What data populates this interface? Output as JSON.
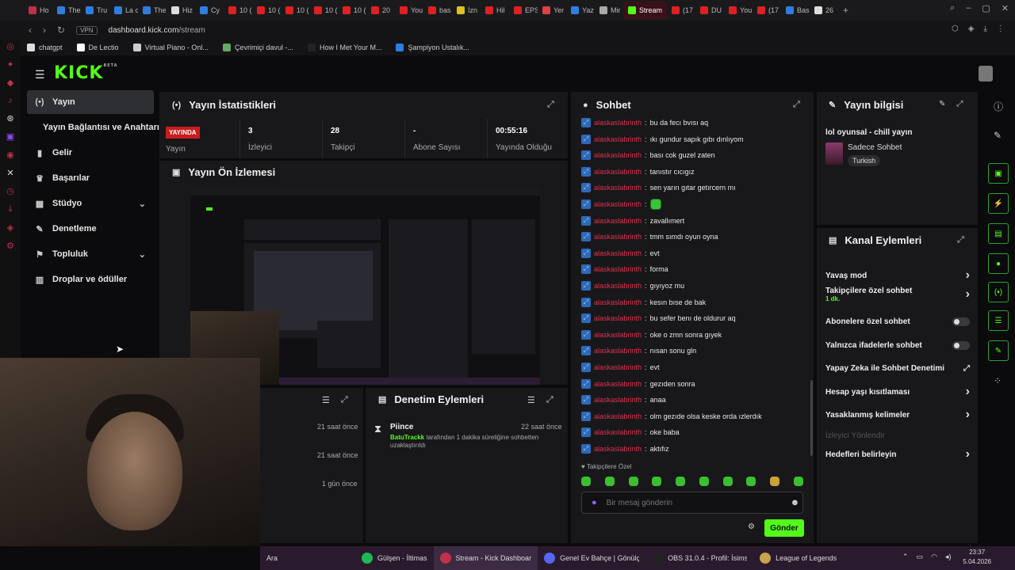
{
  "browser": {
    "tabs": [
      {
        "label": "Ho",
        "color": "#c0304a"
      },
      {
        "label": "The",
        "color": "#2f7de0"
      },
      {
        "label": "Tru",
        "color": "#2f7de0"
      },
      {
        "label": "La c",
        "color": "#2f7de0"
      },
      {
        "label": "The",
        "color": "#2f7de0"
      },
      {
        "label": "Hiz",
        "color": "#ddd"
      },
      {
        "label": "Cy",
        "color": "#2f7de0"
      },
      {
        "label": "10 (",
        "color": "#e02020"
      },
      {
        "label": "10 (",
        "color": "#e02020"
      },
      {
        "label": "10 (",
        "color": "#e02020"
      },
      {
        "label": "10 (",
        "color": "#e02020"
      },
      {
        "label": "10 (",
        "color": "#e02020"
      },
      {
        "label": "20",
        "color": "#e02020"
      },
      {
        "label": "You",
        "color": "#e02020"
      },
      {
        "label": "bas",
        "color": "#e02020"
      },
      {
        "label": "İzn",
        "color": "#e0c020"
      },
      {
        "label": "Hil",
        "color": "#e02020"
      },
      {
        "label": "EPS",
        "color": "#e02020"
      },
      {
        "label": "Yer",
        "color": "#e04040"
      },
      {
        "label": "Yaz",
        "color": "#2f7de0"
      },
      {
        "label": "Mir",
        "color": "#aaa"
      },
      {
        "label": "Stream",
        "color": "#53fc18",
        "active": true
      },
      {
        "label": "(17",
        "color": "#e02020"
      },
      {
        "label": "DU",
        "color": "#e02020"
      },
      {
        "label": "You",
        "color": "#e02020"
      },
      {
        "label": "(17",
        "color": "#e02020"
      },
      {
        "label": "Bas",
        "color": "#2f7de0"
      },
      {
        "label": "26",
        "color": "#ddd"
      }
    ],
    "vpn": "VPN",
    "url_host": "dashboard.kick.com",
    "url_path": "/stream",
    "bookmarks": [
      {
        "label": "chatgpt",
        "color": "#ddd"
      },
      {
        "label": "De Lectio",
        "color": "#fff"
      },
      {
        "label": "Virtual Piano - Onl...",
        "color": "#ccc"
      },
      {
        "label": "Çevrimiçi davul -...",
        "color": "#6a6"
      },
      {
        "label": "How I Met Your M...",
        "color": "#222"
      },
      {
        "label": "Şampiyon Ustalık...",
        "color": "#2f7de0"
      }
    ]
  },
  "kick": {
    "logo": "KICK",
    "logo_sup": "BETA",
    "nav": [
      {
        "label": "Yayın",
        "icon": "broadcast-icon",
        "active": true
      },
      {
        "label": "Yayın Bağlantısı ve Anahtarı",
        "icon": "",
        "sub": true
      },
      {
        "label": "Gelir",
        "icon": "chart-icon"
      },
      {
        "label": "Başarılar",
        "icon": "trophy-icon"
      },
      {
        "label": "Stüdyo",
        "icon": "studio-icon",
        "chevron": true
      },
      {
        "label": "Denetleme",
        "icon": "wrench-icon"
      },
      {
        "label": "Topluluk",
        "icon": "community-icon",
        "chevron": true
      },
      {
        "label": "Droplar ve ödüller",
        "icon": "drops-icon"
      }
    ],
    "stats_panel": {
      "title": "Yayın İstatistikleri",
      "live_badge": "YAYINDA",
      "items": [
        {
          "value": "",
          "label": "Yayın"
        },
        {
          "value": "3",
          "label": "İzleyici"
        },
        {
          "value": "28",
          "label": "Takipçi"
        },
        {
          "value": "-",
          "label": "Abone Sayısı"
        },
        {
          "value": "00:55:16",
          "label": "Yayında Olduğu"
        }
      ]
    },
    "preview_panel": {
      "title": "Yayın Ön İzlemesi"
    },
    "lower_left": {
      "times": [
        "21 saat önce",
        "21 saat önce",
        "1 gün önce"
      ]
    },
    "moderation_panel": {
      "title": "Denetim Eylemleri",
      "entry_user": "Piince",
      "entry_time": "22 saat önce",
      "entry_actor": "BatuTrackk",
      "entry_text": "tarafından 1 dakika süreliğine sohbetten uzaklaştırıldı"
    },
    "chat": {
      "title": "Sohbet",
      "username": "alaskaslabrinth",
      "messages": [
        "bu da fecı bvısı aq",
        "ıkı gundur sapık gıbı dınlıyom",
        "bası cok guzel zaten",
        "tanıstır cıcıgız",
        "sen yarın gıtar getırcern mı",
        "",
        "zavallımert",
        "tmm sımdı oyun oyna",
        "evt",
        "forma",
        "gıyıyoz mu",
        "kesın bıse de bak",
        "bu sefer benı de oldurur aq",
        "oke o zmn sonra gıyek",
        "nısan sonu gln",
        "evt",
        "gezıden sonra",
        "anaa",
        "olm gezıde olsa keske orda ızlerdık",
        "oke baba",
        "aktıfız"
      ],
      "followers_only": "Takipçilere Özel",
      "input_placeholder": "Bir mesaj gönderin",
      "send_label": "Gönder"
    },
    "stream_info": {
      "title": "Yayın bilgisi",
      "stream_title": "lol oyunsal - chill yayın",
      "category": "Sadece Sohbet",
      "language": "Turkish"
    },
    "channel_actions": {
      "title": "Kanal Eylemleri",
      "items": [
        {
          "label": "Yavaş mod",
          "type": "chevron"
        },
        {
          "label": "Takipçilere özel sohbet",
          "sub": "1 dk.",
          "type": "chevron"
        },
        {
          "label": "Abonelere özel sohbet",
          "type": "toggle"
        },
        {
          "label": "Yalnızca ifadelerle sohbet",
          "type": "toggle"
        },
        {
          "label": "Yapay Zeka ile Sohbet Denetimi",
          "type": "external"
        },
        {
          "label": "Hesap yaşı kısıtlaması",
          "type": "chevron"
        },
        {
          "label": "Yasaklanmış kelimeler",
          "type": "chevron"
        },
        {
          "label": "İzleyici Yönlendir",
          "type": "disabled"
        },
        {
          "label": "Hedefleri belirleyin",
          "type": "chevron"
        }
      ]
    }
  },
  "taskbar": {
    "search": "Ara",
    "items": [
      {
        "label": "Gülşen - İltimas",
        "color": "#1db954"
      },
      {
        "label": "Stream - Kick Dashboar",
        "color": "#c0304a",
        "active": true
      },
      {
        "label": "Genel Ev Bahçe | Gönülç",
        "color": "#5865f2"
      },
      {
        "label": "OBS 31.0.4 - Profil: İsimsi",
        "color": "#222"
      },
      {
        "label": "League of Legends",
        "color": "#c8a44a"
      }
    ],
    "time": "23:37",
    "date": "5.04.2026"
  }
}
